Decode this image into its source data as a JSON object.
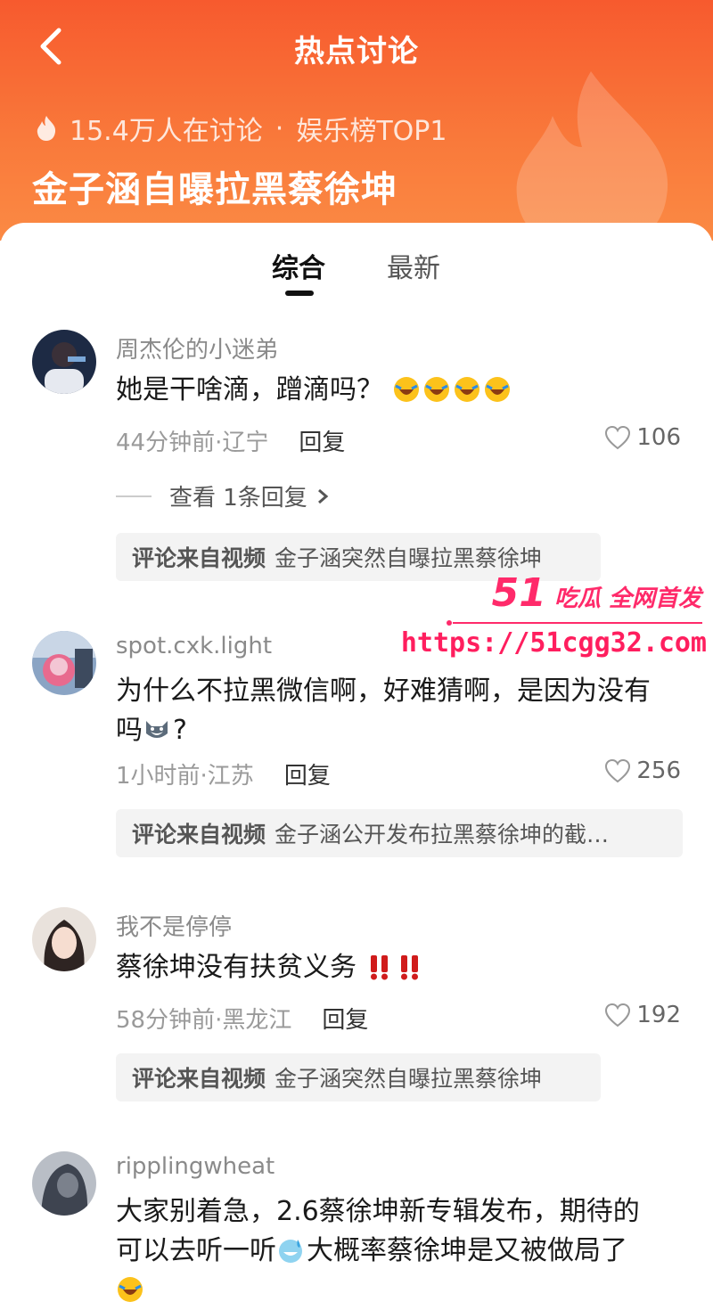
{
  "header": {
    "title": "热点讨论",
    "discussion_count": "15.4万人在讨论",
    "separator": "·",
    "rank": "娱乐榜TOP1",
    "topic": "金子涵自曝拉黑蔡徐坤"
  },
  "tabs": [
    {
      "label": "综合",
      "active": true
    },
    {
      "label": "最新",
      "active": false
    }
  ],
  "comments": [
    {
      "user": "周杰伦的小迷弟",
      "text": "她是干啥滴，蹭滴吗？",
      "emoji": [
        "laugh-cry",
        "laugh-cry",
        "laugh-cry",
        "laugh-cry"
      ],
      "time_loc": "44分钟前·辽宁",
      "reply": "回复",
      "likes": "106",
      "view_replies": "查看 1条回复",
      "source_label": "评论来自视频",
      "source_title": "金子涵突然自曝拉黑蔡徐坤"
    },
    {
      "user": "spot.cxk.light",
      "text_line1": "为什么不拉黑微信啊，好难猜啊，是因为没有",
      "text_line2": "吗",
      "text_line2_tail": "?",
      "emoji": [
        "husky-face"
      ],
      "time_loc": "1小时前·江苏",
      "reply": "回复",
      "likes": "256",
      "source_label": "评论来自视频",
      "source_title": "金子涵公开发布拉黑蔡徐坤的截…"
    },
    {
      "user": "我不是停停",
      "text": "蔡徐坤没有扶贫义务",
      "emoji": [
        "double-exclamation",
        "double-exclamation"
      ],
      "time_loc": "58分钟前·黑龙江",
      "reply": "回复",
      "likes": "192",
      "source_label": "评论来自视频",
      "source_title": "金子涵突然自曝拉黑蔡徐坤"
    },
    {
      "user": "ripplingwheat",
      "text_line1": "大家别着急，2.6蔡徐坤新专辑发布，期待的",
      "text_line2a": "可以去听一听",
      "text_line2b": "大概率蔡徐坤是又被做局了",
      "emoji": [
        "sweat-grin",
        "laugh-cry"
      ]
    }
  ],
  "watermark": {
    "num": "51",
    "slogan": "吃瓜 全网首发",
    "url": "https://51cgg32.com"
  },
  "colors": {
    "header_top": "#f75a2e",
    "header_bottom": "#fb8a44",
    "watermark": "#ff2a6a",
    "like_gray": "#666666"
  },
  "icons": [
    "back-chevron-icon",
    "fire-icon",
    "heart-icon",
    "chevron-right-icon"
  ]
}
